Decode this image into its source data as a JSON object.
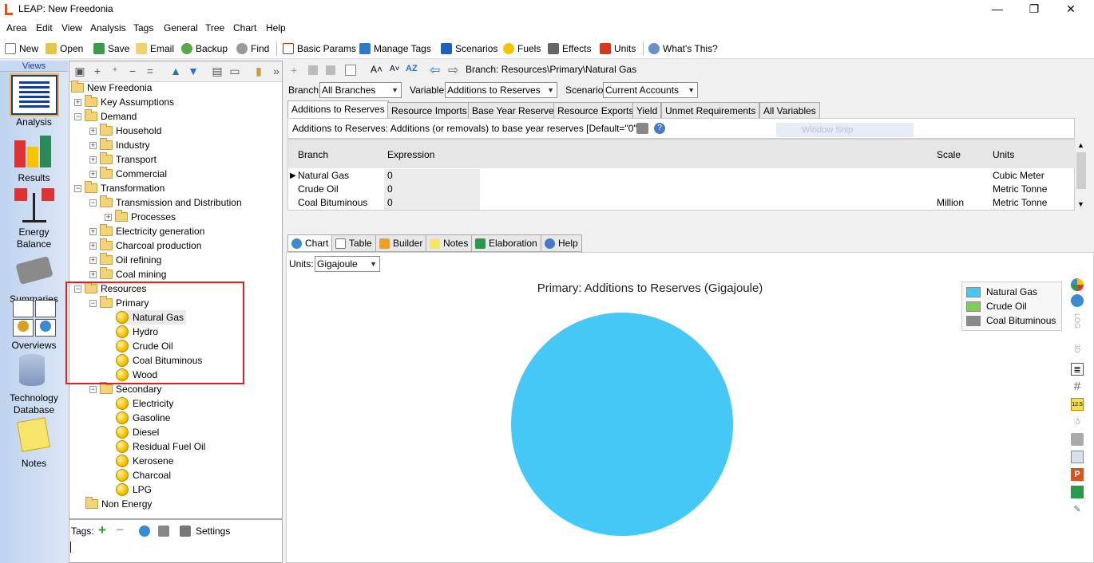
{
  "window": {
    "title": "LEAP: New Freedonia",
    "minimize": "—",
    "restore": "❐",
    "close": "✕"
  },
  "menu": [
    "Area",
    "Edit",
    "View",
    "Analysis",
    "Tags",
    "General",
    "Tree",
    "Chart",
    "Help"
  ],
  "toolbar": {
    "new": "New",
    "open": "Open",
    "save": "Save",
    "email": "Email",
    "backup": "Backup",
    "find": "Find",
    "basic_params": "Basic Params",
    "manage_tags": "Manage Tags",
    "scenarios": "Scenarios",
    "fuels": "Fuels",
    "effects": "Effects",
    "units": "Units",
    "whats_this": "What's This?"
  },
  "views": {
    "header": "Views",
    "items": [
      {
        "label": "Analysis"
      },
      {
        "label": "Results"
      },
      {
        "label": "Energy Balance"
      },
      {
        "label": "Summaries"
      },
      {
        "label": "Overviews"
      },
      {
        "label": "Technology Database"
      },
      {
        "label": "Notes"
      }
    ]
  },
  "tree": {
    "root": "New Freedonia",
    "key_assumptions": "Key Assumptions",
    "demand": "Demand",
    "household": "Household",
    "industry": "Industry",
    "transport": "Transport",
    "commercial": "Commercial",
    "transformation": "Transformation",
    "tnd": "Transmission and Distribution",
    "processes": "Processes",
    "electricity_generation": "Electricity generation",
    "charcoal_production": "Charcoal production",
    "oil_refining": "Oil refining",
    "coal_mining": "Coal mining",
    "resources": "Resources",
    "primary": "Primary",
    "natural_gas": "Natural Gas",
    "hydro": "Hydro",
    "crude_oil": "Crude Oil",
    "coal_bituminous": "Coal Bituminous",
    "wood": "Wood",
    "secondary": "Secondary",
    "electricity": "Electricity",
    "gasoline": "Gasoline",
    "diesel": "Diesel",
    "residual_fuel_oil": "Residual Fuel Oil",
    "kerosene": "Kerosene",
    "charcoal": "Charcoal",
    "lpg": "LPG",
    "non_energy": "Non Energy"
  },
  "tags": {
    "label": "Tags:",
    "settings": "Settings"
  },
  "right": {
    "breadcrumb": "Branch: Resources\\Primary\\Natural Gas",
    "branch_label": "Branch:",
    "branch_value": "All Branches",
    "variable_label": "Variable:",
    "variable_value": "Additions to Reserves",
    "scenario_label": "Scenario:",
    "scenario_value": "Current Accounts",
    "tabs": [
      "Additions to Reserves",
      "Resource Imports",
      "Base Year Reserves",
      "Resource Exports",
      "Yield",
      "Unmet Requirements",
      "All Variables"
    ],
    "description": "Additions to Reserves: Additions (or removals) to base year reserves [Default=\"0\"]",
    "ghost": "Window Snip",
    "grid": {
      "headers": {
        "branch": "Branch",
        "expression": "Expression",
        "scale": "Scale",
        "units": "Units"
      },
      "rows": [
        {
          "branch": "Natural Gas",
          "expression": "0",
          "scale": "",
          "units": "Cubic Meter"
        },
        {
          "branch": "Crude Oil",
          "expression": "0",
          "scale": "",
          "units": "Metric Tonne"
        },
        {
          "branch": "Coal Bituminous",
          "expression": "0",
          "scale": "Million",
          "units": "Metric Tonne"
        }
      ]
    },
    "bottom_tabs": [
      "Chart",
      "Table",
      "Builder",
      "Notes",
      "Elaboration",
      "Help"
    ],
    "units_label": "Units:",
    "units_value": "Gigajoule",
    "side_labels": {
      "log": "LOG",
      "three_d": "3D",
      "value": "12.5"
    }
  },
  "chart_data": {
    "type": "pie",
    "title": "Primary: Additions to Reserves (Gigajoule)",
    "categories": [
      "Natural Gas",
      "Crude Oil",
      "Coal Bituminous"
    ],
    "values": [
      1,
      0,
      0
    ],
    "colors": [
      "#45c8f5",
      "#7fcd52",
      "#8a8a8a"
    ],
    "legend_position": "top-right"
  }
}
